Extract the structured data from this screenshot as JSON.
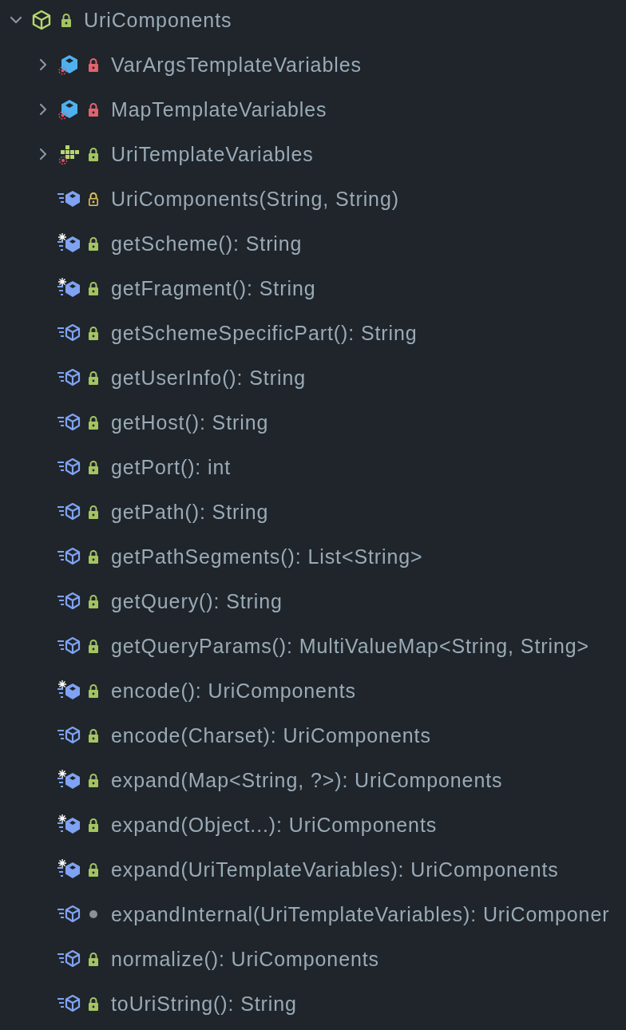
{
  "tree": [
    {
      "label": "UriComponents",
      "kind": "class",
      "access": {
        "kind": "lock",
        "color": "#a4c462"
      },
      "expanded": true,
      "children": [
        {
          "label": "VarArgsTemplateVariables",
          "kind": "inner-class",
          "access": {
            "kind": "lock",
            "color": "#e0646e"
          },
          "expanded": false
        },
        {
          "label": "MapTemplateVariables",
          "kind": "inner-class",
          "access": {
            "kind": "lock",
            "color": "#e0646e"
          },
          "expanded": false
        },
        {
          "label": "UriTemplateVariables",
          "kind": "interface",
          "access": {
            "kind": "lock",
            "color": "#a4c462"
          },
          "expanded": false
        },
        {
          "label": "UriComponents(String, String)",
          "kind": "abstract-method",
          "access": {
            "kind": "outline-lock",
            "color": "#e2c15a"
          }
        },
        {
          "label": "getScheme(): String",
          "kind": "static-method",
          "access": {
            "kind": "lock",
            "color": "#a4c462"
          }
        },
        {
          "label": "getFragment(): String",
          "kind": "static-method",
          "access": {
            "kind": "lock",
            "color": "#a4c462"
          }
        },
        {
          "label": "getSchemeSpecificPart(): String",
          "kind": "method",
          "access": {
            "kind": "lock",
            "color": "#a4c462"
          }
        },
        {
          "label": "getUserInfo(): String",
          "kind": "method",
          "access": {
            "kind": "lock",
            "color": "#a4c462"
          }
        },
        {
          "label": "getHost(): String",
          "kind": "method",
          "access": {
            "kind": "lock",
            "color": "#a4c462"
          }
        },
        {
          "label": "getPort(): int",
          "kind": "method",
          "access": {
            "kind": "lock",
            "color": "#a4c462"
          }
        },
        {
          "label": "getPath(): String",
          "kind": "method",
          "access": {
            "kind": "lock",
            "color": "#a4c462"
          }
        },
        {
          "label": "getPathSegments(): List<String>",
          "kind": "method",
          "access": {
            "kind": "lock",
            "color": "#a4c462"
          }
        },
        {
          "label": "getQuery(): String",
          "kind": "method",
          "access": {
            "kind": "lock",
            "color": "#a4c462"
          }
        },
        {
          "label": "getQueryParams(): MultiValueMap<String, String>",
          "kind": "method",
          "access": {
            "kind": "lock",
            "color": "#a4c462"
          }
        },
        {
          "label": "encode(): UriComponents",
          "kind": "static-method",
          "access": {
            "kind": "lock",
            "color": "#a4c462"
          }
        },
        {
          "label": "encode(Charset): UriComponents",
          "kind": "method",
          "access": {
            "kind": "lock",
            "color": "#a4c462"
          }
        },
        {
          "label": "expand(Map<String, ?>): UriComponents",
          "kind": "static-method",
          "access": {
            "kind": "lock",
            "color": "#a4c462"
          }
        },
        {
          "label": "expand(Object...): UriComponents",
          "kind": "static-method",
          "access": {
            "kind": "lock",
            "color": "#a4c462"
          }
        },
        {
          "label": "expand(UriTemplateVariables): UriComponents",
          "kind": "static-method",
          "access": {
            "kind": "lock",
            "color": "#a4c462"
          }
        },
        {
          "label": "expandInternal(UriTemplateVariables): UriComponer",
          "kind": "method",
          "access": {
            "kind": "dot",
            "color": "#8a9096"
          }
        },
        {
          "label": "normalize(): UriComponents",
          "kind": "method",
          "access": {
            "kind": "lock",
            "color": "#a4c462"
          }
        },
        {
          "label": "toUriString(): String",
          "kind": "method",
          "access": {
            "kind": "lock",
            "color": "#a4c462"
          }
        }
      ]
    }
  ]
}
